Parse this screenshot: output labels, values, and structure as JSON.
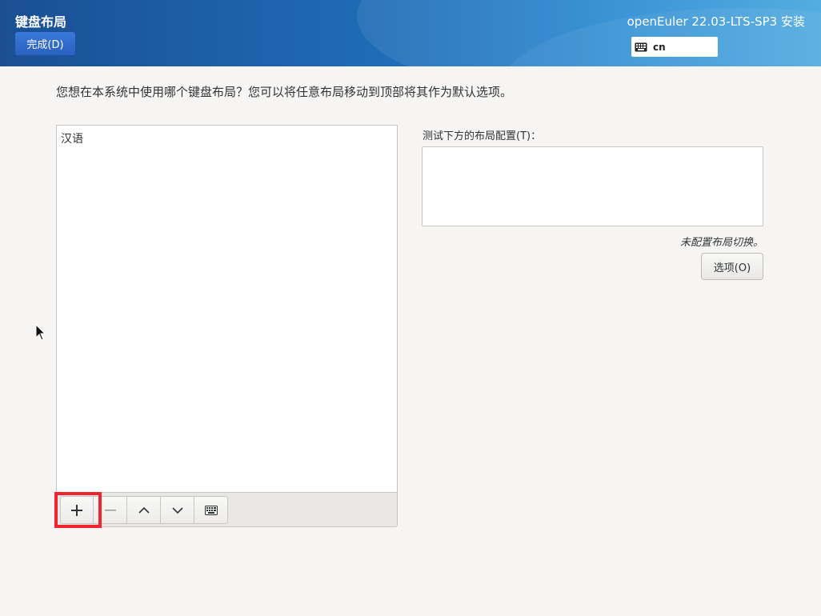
{
  "header": {
    "spoke_title": "键盘布局",
    "done_label": "完成(D)",
    "product_title": "openEuler 22.03-LTS-SP3 安装",
    "keyboard_indicator": {
      "icon": "keyboard-icon",
      "value": "cn"
    }
  },
  "intro_text": "您想在本系统中使用哪个键盘布局？您可以将任意布局移动到顶部将其作为默认选项。",
  "layouts": {
    "items": [
      {
        "label": "汉语"
      }
    ]
  },
  "toolbar": {
    "buttons": [
      {
        "name": "add-layout-button",
        "icon": "plus-icon"
      },
      {
        "name": "remove-layout-button",
        "icon": "minus-icon"
      },
      {
        "name": "move-up-button",
        "icon": "chevron-up-icon"
      },
      {
        "name": "move-down-button",
        "icon": "chevron-down-icon"
      },
      {
        "name": "preview-layout-button",
        "icon": "keyboard-icon"
      }
    ]
  },
  "test": {
    "label": "测试下方的布局配置(T)：",
    "value": ""
  },
  "switch_note": "未配置布局切换。",
  "options_label": "选项(O)",
  "colors": {
    "header_start": "#1a4f93",
    "header_end": "#46a6de",
    "done_button": "#2a62c0",
    "highlight": "#f2242d",
    "background": "#f6f5f4"
  }
}
